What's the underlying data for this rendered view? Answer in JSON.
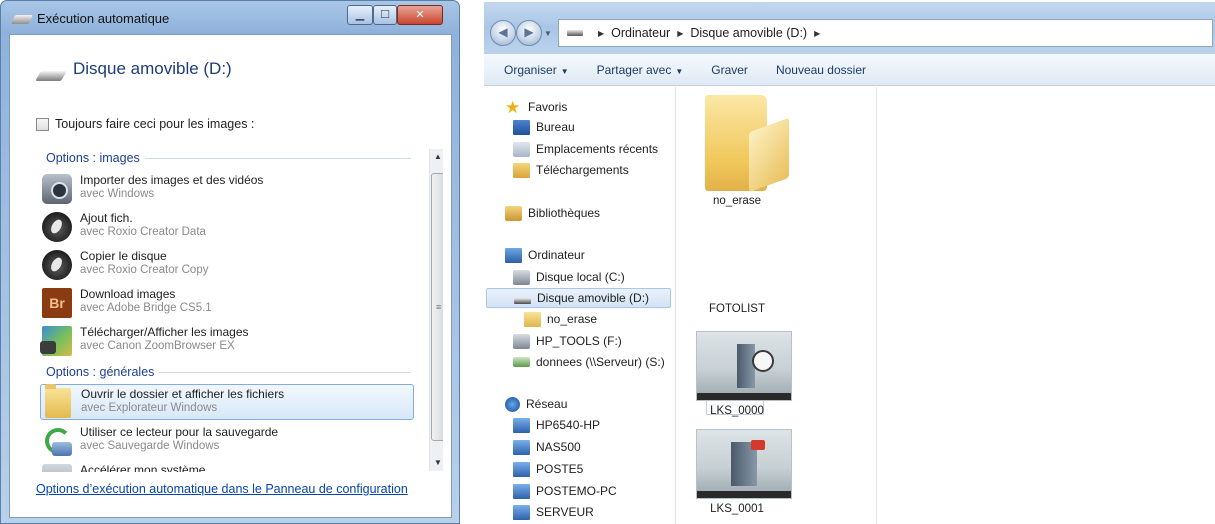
{
  "autoplay": {
    "title": "Exécution automatique",
    "drive_title": "Disque amovible (D:)",
    "always_label": "Toujours faire ceci pour les images :",
    "section_images": "Options : images",
    "section_general": "Options : générales",
    "items": [
      {
        "main": "Importer des images et des vidéos",
        "sub": "avec Windows",
        "icon": "camera-icon"
      },
      {
        "main": "Ajout fich.",
        "sub": "avec Roxio Creator Data",
        "icon": "roxio-icon"
      },
      {
        "main": "Copier le disque",
        "sub": "avec Roxio Creator Copy",
        "icon": "roxio-icon"
      },
      {
        "main": "Download images",
        "sub": "avec Adobe Bridge CS5.1",
        "icon": "adobe-bridge-icon",
        "icon_text": "Br"
      },
      {
        "main": "Télécharger/Afficher les images",
        "sub": "avec Canon ZoomBrowser EX",
        "icon": "canon-zoombrowser-icon"
      },
      {
        "main": "Ouvrir le dossier et afficher les fichiers",
        "sub": "avec Explorateur Windows",
        "icon": "folder-icon",
        "selected": true
      },
      {
        "main": "Utiliser ce lecteur pour la sauvegarde",
        "sub": "avec Sauvegarde Windows",
        "icon": "backup-icon"
      },
      {
        "main": "Accélérer mon système",
        "sub": "",
        "icon": "system-icon"
      }
    ],
    "control_panel_link": "Options d’exécution automatique dans le Panneau de configuration"
  },
  "explorer": {
    "breadcrumb": [
      "Ordinateur",
      "Disque amovible (D:)"
    ],
    "toolbar": {
      "organize": "Organiser",
      "share": "Partager avec",
      "burn": "Graver",
      "new_folder": "Nouveau dossier"
    },
    "nav": {
      "favorites": "Favoris",
      "desktop": "Bureau",
      "recent": "Emplacements récents",
      "downloads": "Téléchargements",
      "libraries": "Bibliothèques",
      "computer": "Ordinateur",
      "local_disk": "Disque local (C:)",
      "removable": "Disque amovible (D:)",
      "no_erase": "no_erase",
      "hp_tools": "HP_TOOLS (F:)",
      "donnees": "donnees (\\\\Serveur) (S:)",
      "network": "Réseau",
      "net_items": [
        "HP6540-HP",
        "NAS500",
        "POSTE5",
        "POSTEMO-PC",
        "SERVEUR"
      ]
    },
    "files": [
      {
        "name": "no_erase",
        "type": "folder"
      },
      {
        "name": "FOTOLIST",
        "type": "document"
      },
      {
        "name": "LKS_0000",
        "type": "image"
      },
      {
        "name": "LKS_0001",
        "type": "image"
      }
    ]
  },
  "colors": {
    "link": "#0645ad",
    "section_header": "#1e3f97",
    "selection_border": "#84acdd"
  }
}
